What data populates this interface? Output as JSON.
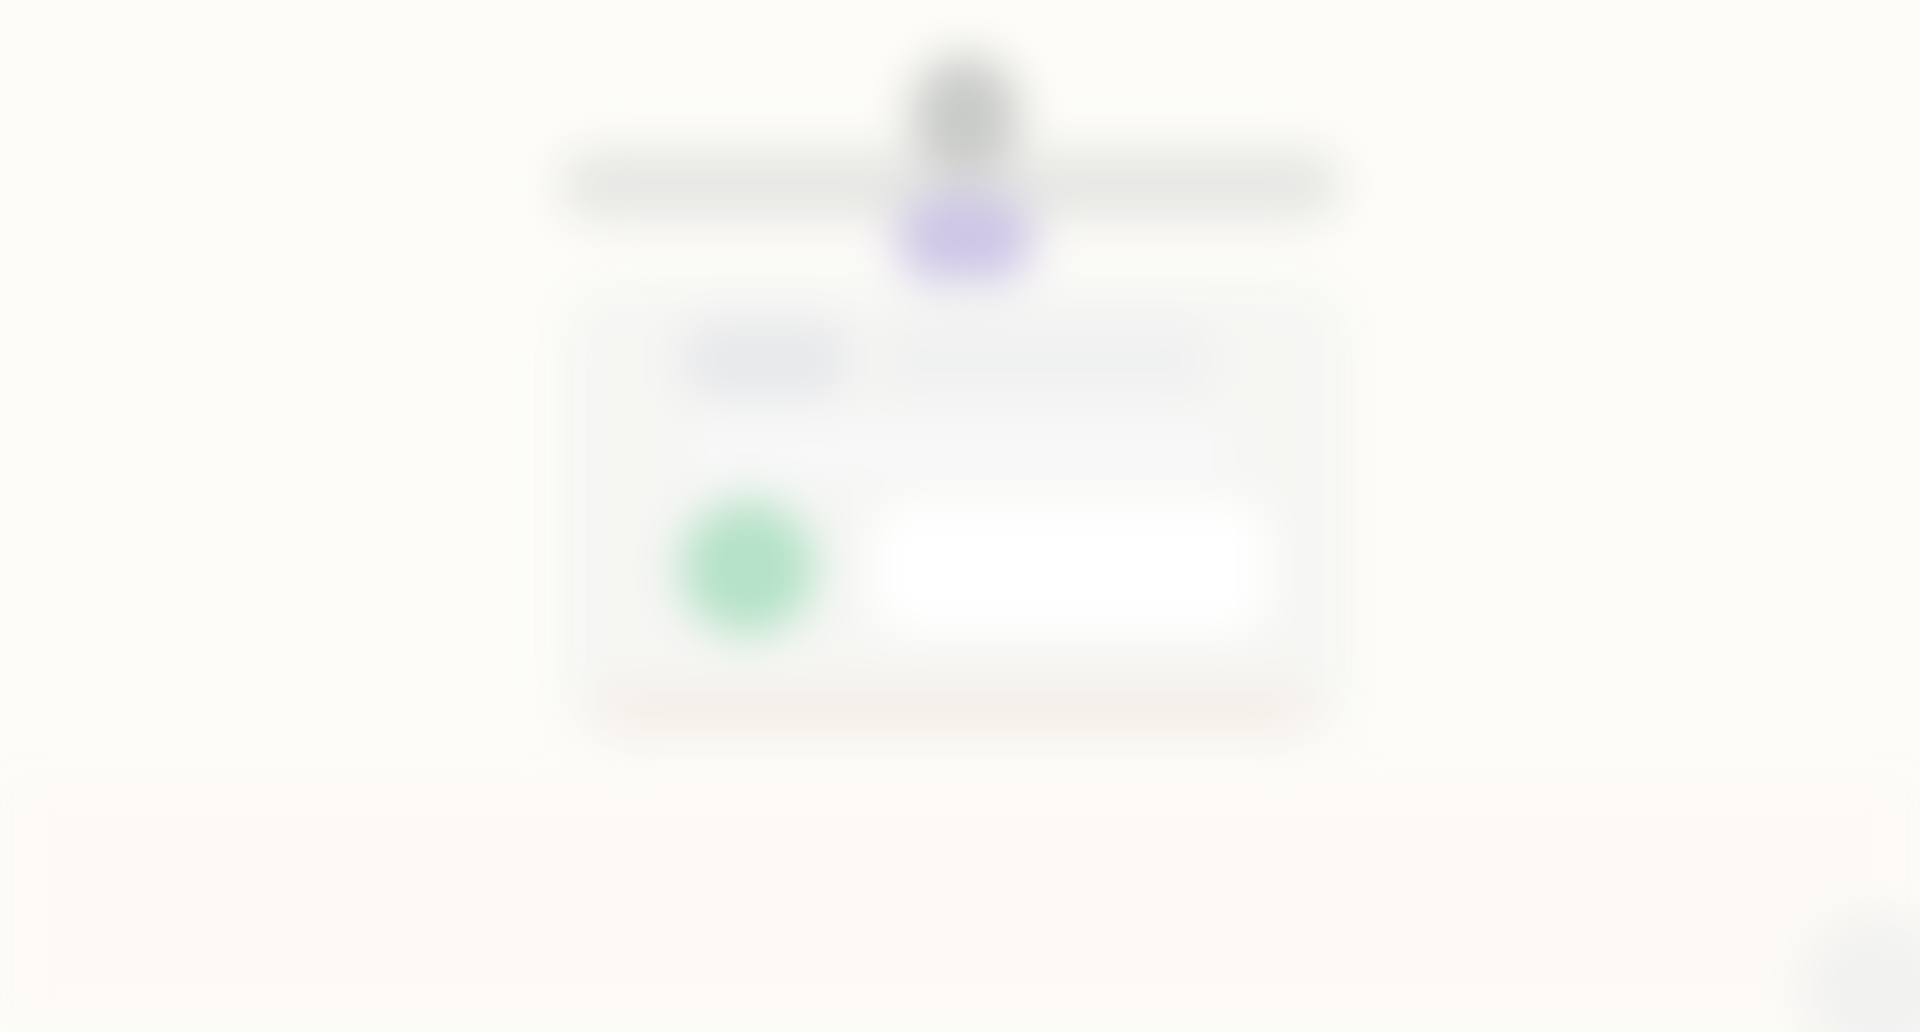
{
  "screen": {
    "state": "",
    "colors": {
      "background": "#fdfcf8",
      "lower_band": "#fdfaf6",
      "top_bar": "#e6e6e3",
      "avatar": "#cdc6e6",
      "green_dot": "#b5e2c8",
      "card": "#f6f6f3",
      "panel": "#ffffff"
    }
  }
}
